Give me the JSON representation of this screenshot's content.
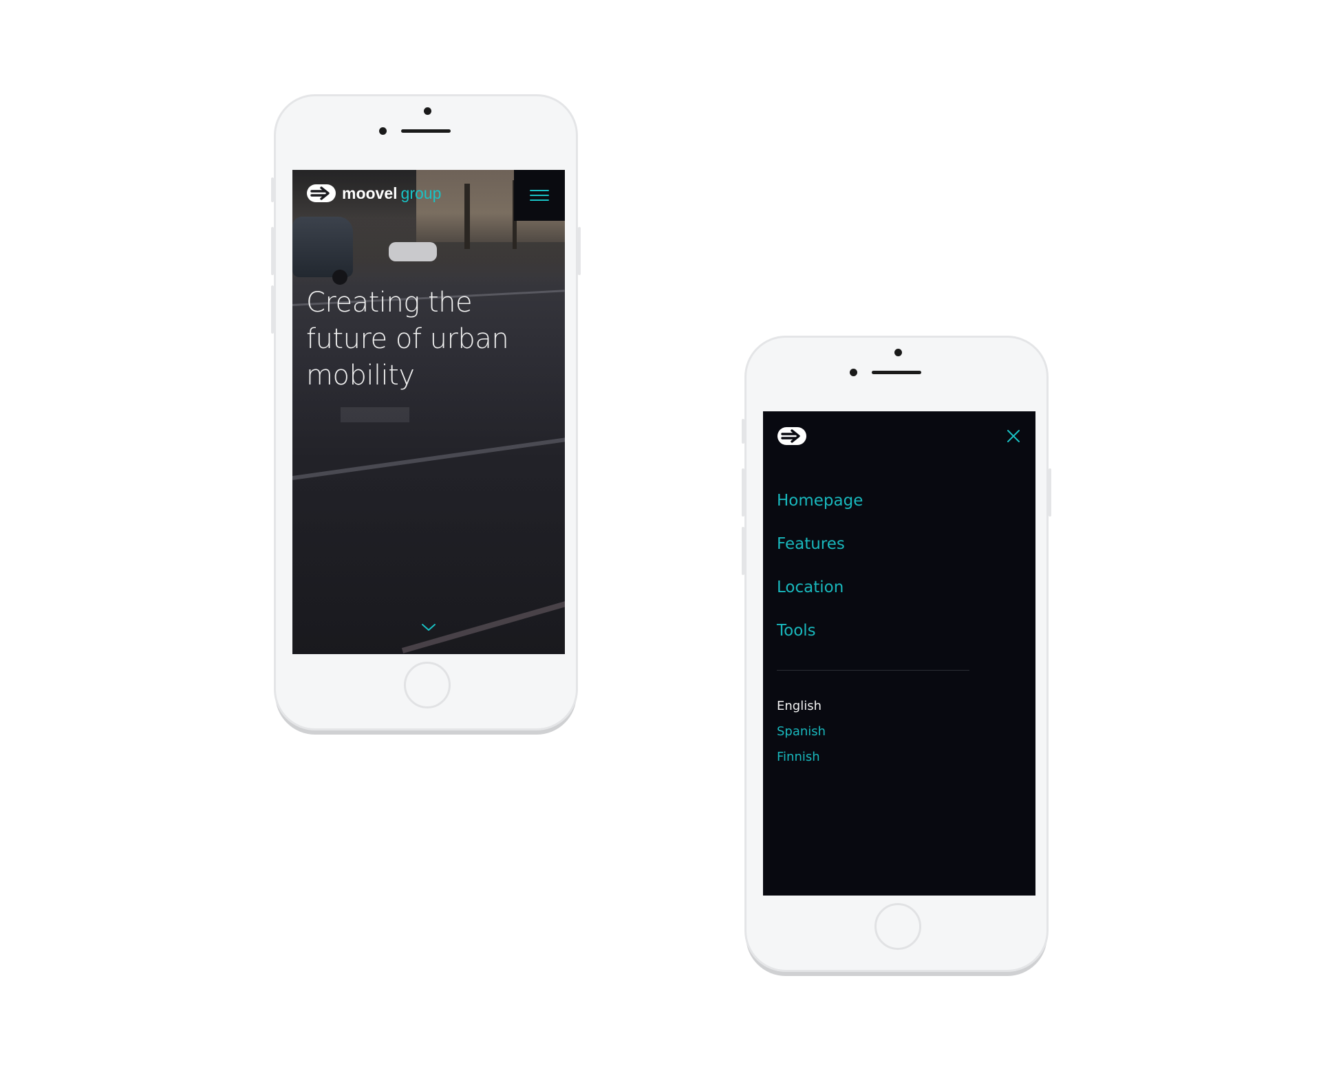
{
  "hero_screen": {
    "brand": {
      "name_bold": "moovel",
      "name_light": "group"
    },
    "menu_icon": "hamburger-icon",
    "headline": "Creating the future of urban mobility",
    "scroll_icon": "chevron-down-icon"
  },
  "menu_screen": {
    "logo_icon": "moovel-logo-icon",
    "close_icon": "close-icon",
    "nav_items": [
      {
        "label": "Homepage"
      },
      {
        "label": "Features"
      },
      {
        "label": "Location"
      },
      {
        "label": "Tools"
      }
    ],
    "languages": [
      {
        "label": "English",
        "active": true
      },
      {
        "label": "Spanish",
        "active": false
      },
      {
        "label": "Finnish",
        "active": false
      }
    ]
  },
  "colors": {
    "accent": "#19c3c6",
    "menu_background": "#080910",
    "phone_body": "#f5f6f7",
    "page_background": "#ffffff"
  }
}
